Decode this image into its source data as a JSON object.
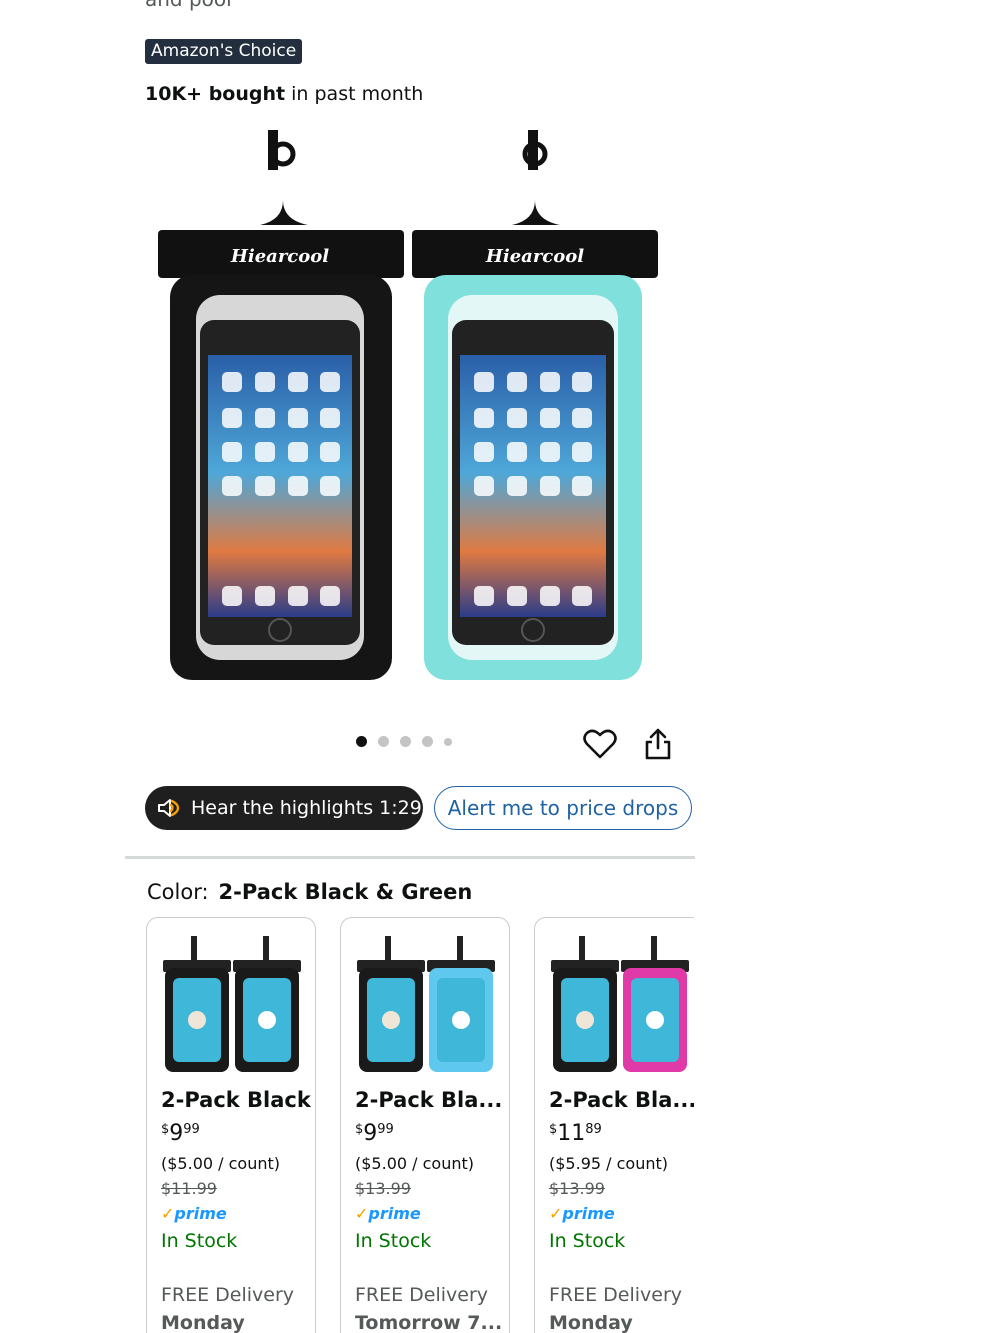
{
  "product": {
    "title_fragment": "and pool",
    "badge": "Amazon's Choice",
    "bought_bold": "10K+ bought",
    "bought_rest": " in past month",
    "brand_on_image": "Hiearcool"
  },
  "gallery": {
    "dots_total": 5,
    "active_index": 0
  },
  "actions": {
    "hear_label": "Hear the highlights 1:29",
    "alert_label": "Alert me to price drops"
  },
  "color": {
    "label": "Color:",
    "selected": "2-Pack Black & Green"
  },
  "swatches": [
    {
      "name": "2-Pack Black",
      "price_dollars": "9",
      "price_cents": "99",
      "price_symbol": "$",
      "unit": "($5.00 / count)",
      "was": "$11.99",
      "prime": "prime",
      "stock": "In Stock",
      "delivery": "FREE Delivery",
      "delivery_day": "Monday",
      "pouch_colors": [
        "#1a1a1a",
        "#1a1a1a"
      ]
    },
    {
      "name": "2-Pack Bla...",
      "price_dollars": "9",
      "price_cents": "99",
      "price_symbol": "$",
      "unit": "($5.00 / count)",
      "was": "$13.99",
      "prime": "prime",
      "stock": "In Stock",
      "delivery": "FREE Delivery",
      "delivery_day": "Tomorrow 7...",
      "pouch_colors": [
        "#1a1a1a",
        "#5ec8ef"
      ]
    },
    {
      "name": "2-Pack Bla...",
      "price_dollars": "11",
      "price_cents": "89",
      "price_symbol": "$",
      "unit": "($5.95 / count)",
      "was": "$13.99",
      "prime": "prime",
      "stock": "In Stock",
      "delivery": "FREE Delivery",
      "delivery_day": "Monday",
      "pouch_colors": [
        "#1a1a1a",
        "#e03aa8"
      ]
    }
  ],
  "colors": {
    "badge_bg": "#232f3e",
    "link_blue": "#2162a1",
    "in_stock_green": "#007600",
    "prime_blue": "#1a98ff",
    "teal_pouch": "#7fe0dc"
  },
  "icons": [
    "speaker-icon",
    "heart-icon",
    "share-icon",
    "prime-check-icon"
  ]
}
